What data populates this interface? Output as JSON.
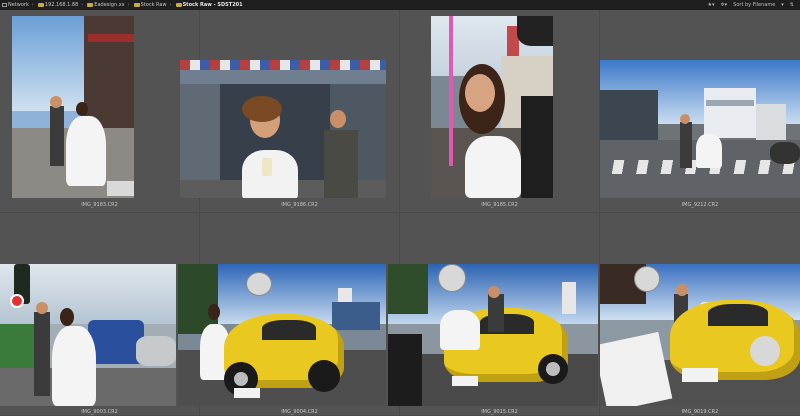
{
  "path": {
    "items": [
      {
        "label": "Network",
        "bold": false,
        "icon": "network-icon"
      },
      {
        "label": "192.168.1.88",
        "bold": false,
        "icon": "folder-icon"
      },
      {
        "label": "Eadesign.xx",
        "bold": false,
        "icon": "folder-icon"
      },
      {
        "label": "Stock Raw",
        "bold": false,
        "icon": "folder-icon"
      },
      {
        "label": "Stock Raw - SDST201",
        "bold": true,
        "icon": "folder-icon"
      }
    ]
  },
  "toolbar": {
    "options_icon": "gear-icon",
    "sort_label": "Sort by Filename"
  },
  "thumbnails": [
    {
      "filename": "IMG_9183.CR2"
    },
    {
      "filename": "IMG_9186.CR2"
    },
    {
      "filename": "IMG_9185.CR2"
    },
    {
      "filename": "IMG_9212.CR2"
    },
    {
      "filename": "IMG_9003.CR2"
    },
    {
      "filename": "IMG_9004.CR2"
    },
    {
      "filename": "IMG_9015.CR2"
    },
    {
      "filename": "IMG_9019.CR2"
    }
  ]
}
